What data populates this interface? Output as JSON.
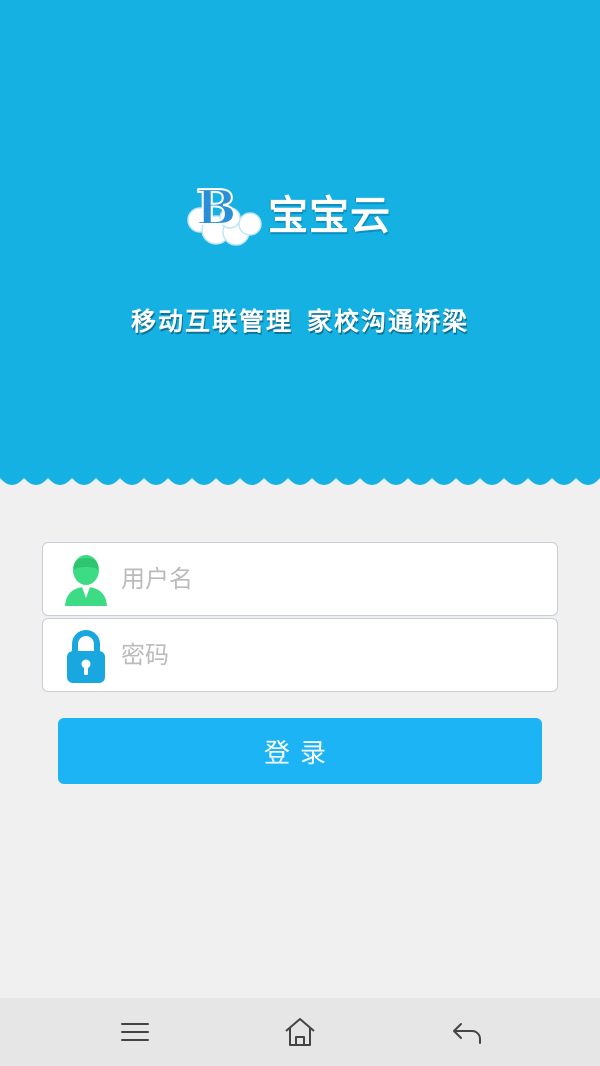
{
  "brand": {
    "name": "宝宝云",
    "logo_letter": "B",
    "slogan_left": "移动互联管理",
    "slogan_right": "家校沟通桥梁"
  },
  "login_form": {
    "username_placeholder": "用户名",
    "password_placeholder": "密码",
    "login_label": "登录"
  },
  "icons": {
    "username": "user-icon",
    "password": "lock-icon",
    "nav_menu": "menu-icon",
    "nav_home": "home-icon",
    "nav_back": "back-icon"
  },
  "colors": {
    "header_bg": "#15b1e3",
    "page_bg": "#f0f0f0",
    "button_bg": "#1cb4f5",
    "user_icon": "#3ddc84",
    "lock_icon": "#19a7e0"
  }
}
